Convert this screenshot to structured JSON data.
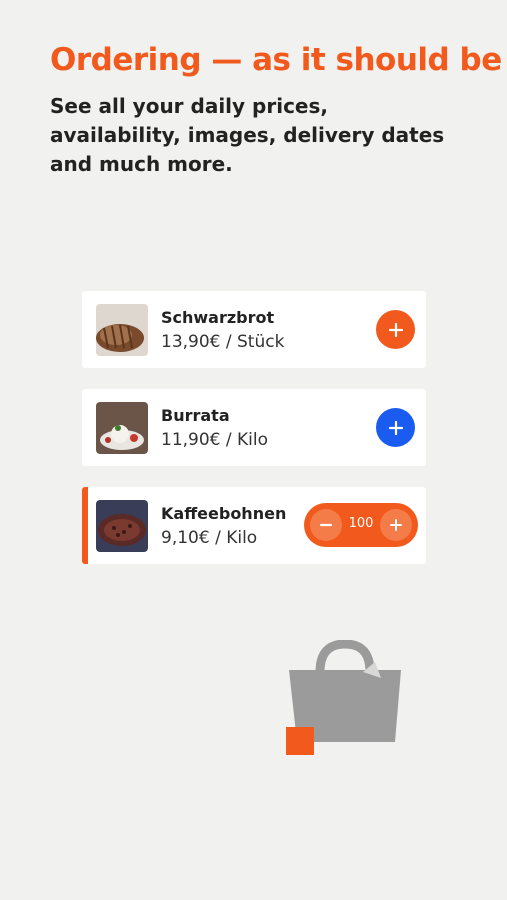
{
  "header": {
    "title": "Ordering — as it should be",
    "subtitle": "See all your daily prices, availability, images, delivery dates and much more."
  },
  "products": [
    {
      "name": "Schwarzbrot",
      "price": "13,90€ / Stück",
      "button_color": "#f15a1c",
      "icon": "plus-icon"
    },
    {
      "name": "Burrata",
      "price": "11,90€ / Kilo",
      "button_color": "#1a5bf0",
      "icon": "plus-icon"
    },
    {
      "name": "Kaffeebohnen",
      "price": "9,10€ / Kilo",
      "quantity": "100",
      "icon": "minus-plus-stepper"
    }
  ],
  "colors": {
    "accent": "#f15a1c",
    "blue": "#1a5bf0",
    "bag": "#9b9b9b",
    "background": "#f1f1f0"
  }
}
